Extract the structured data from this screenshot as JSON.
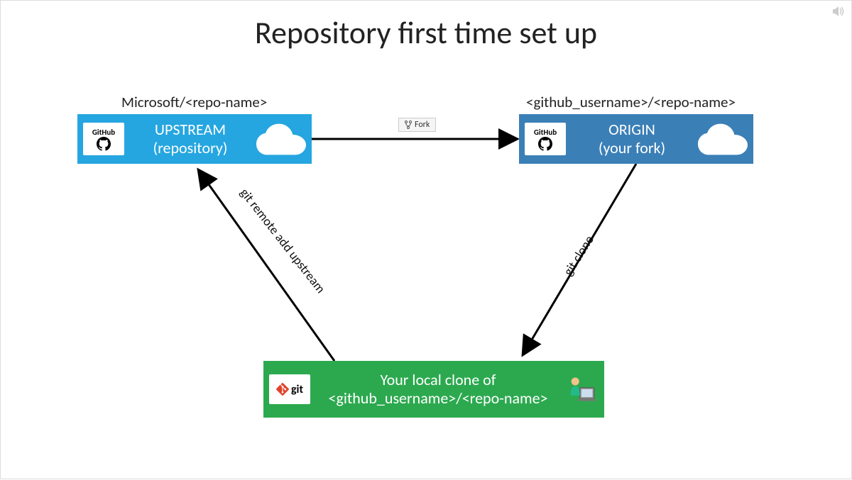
{
  "title": "Repository first time set up",
  "upstream": {
    "label_above": "Microsoft/<repo-name>",
    "line1": "UPSTREAM",
    "line2": "(repository)",
    "badge": "GitHub"
  },
  "origin": {
    "label_above": "<github_username>/<repo-name>",
    "line1": "ORIGIN",
    "line2": "(your fork)",
    "badge": "GitHub"
  },
  "local": {
    "line1": "Your local clone of",
    "line2": "<github_username>/<repo-name>",
    "badge": "git"
  },
  "arrows": {
    "fork_label": "Fork",
    "clone_label": "git clone",
    "remote_label": "git remote add upstream"
  },
  "colors": {
    "upstream": "#25a6e0",
    "origin": "#3b7fb7",
    "local": "#2ca94f"
  }
}
